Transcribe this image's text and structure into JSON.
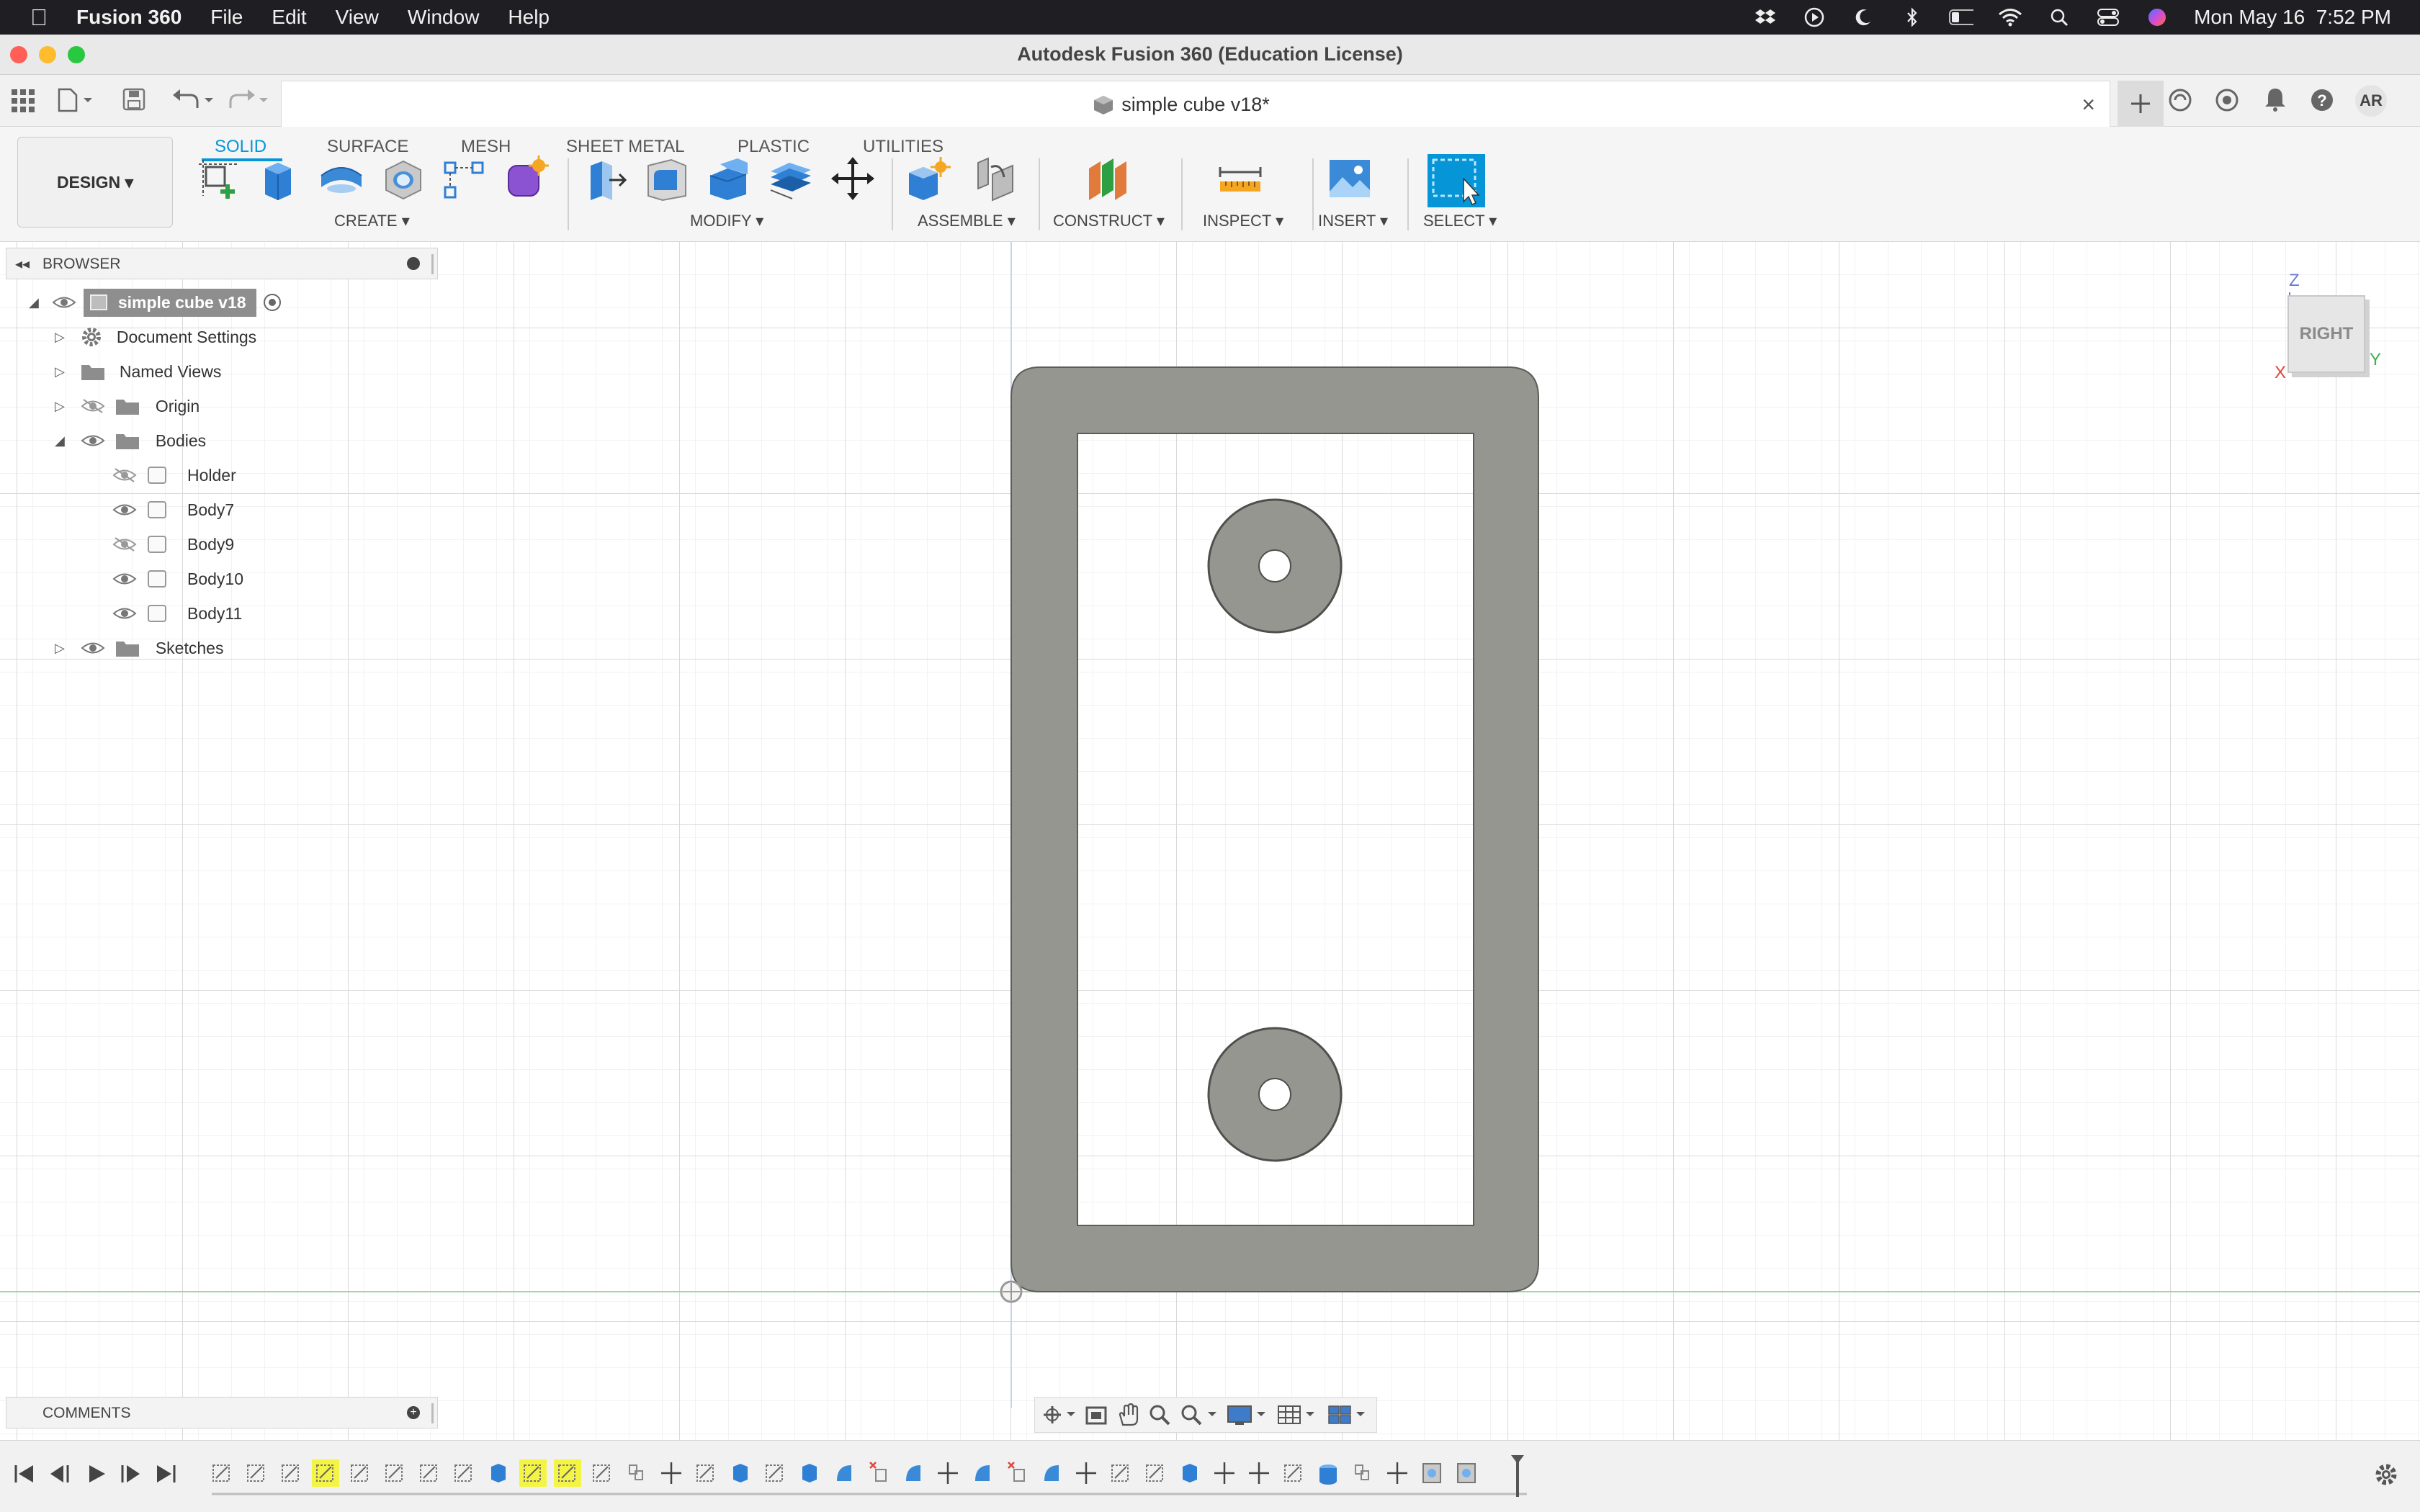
{
  "menubar": {
    "app_name": "Fusion 360",
    "menus": [
      "File",
      "Edit",
      "View",
      "Window",
      "Help"
    ],
    "datetime": "Mon May 16  7:52 PM"
  },
  "window": {
    "title": "Autodesk Fusion 360 (Education License)"
  },
  "document_tab": {
    "label": "simple cube v18*"
  },
  "account": {
    "initials": "AR"
  },
  "workspace": {
    "label": "DESIGN ▾"
  },
  "toolbar_tabs": [
    "SOLID",
    "SURFACE",
    "MESH",
    "SHEET METAL",
    "PLASTIC",
    "UTILITIES"
  ],
  "toolbar_groups": [
    "CREATE ▾",
    "MODIFY ▾",
    "ASSEMBLE ▾",
    "CONSTRUCT ▾",
    "INSPECT ▾",
    "INSERT ▾",
    "SELECT ▾"
  ],
  "browser": {
    "title": "BROWSER",
    "root": "simple cube v18",
    "items": [
      "Document Settings",
      "Named Views",
      "Origin",
      "Bodies"
    ],
    "bodies": [
      "Holder",
      "Body7",
      "Body9",
      "Body10",
      "Body11"
    ],
    "sketches": "Sketches"
  },
  "comments": {
    "title": "COMMENTS"
  },
  "viewcube": {
    "face": "RIGHT",
    "axis_z": "Z",
    "axis_x": "X",
    "axis_y": "Y"
  },
  "colors": {
    "accent": "#0696d7",
    "body_fill": "#969691",
    "origin_line": "#9fd79f"
  }
}
